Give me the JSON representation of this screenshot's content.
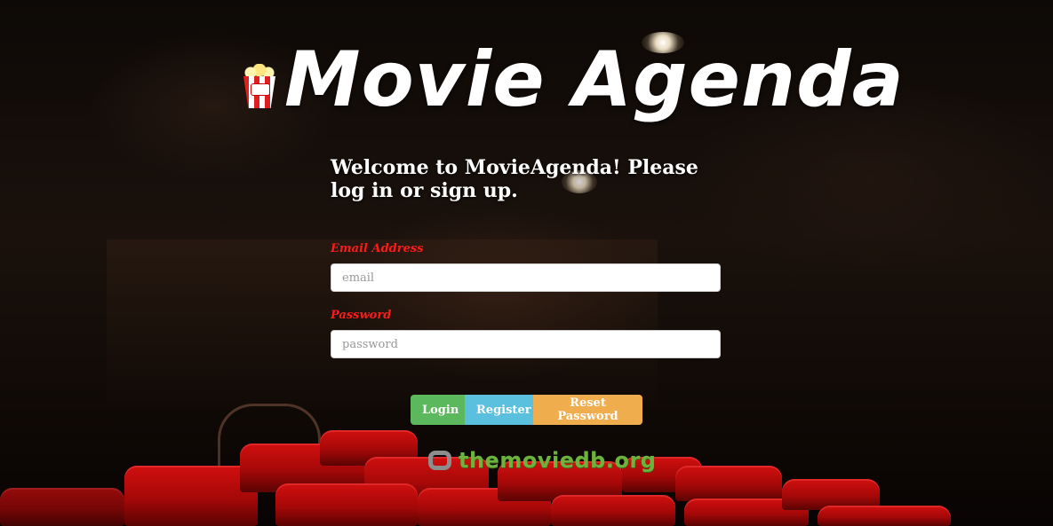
{
  "header": {
    "app_title": "Movie Agenda",
    "logo_icon": "popcorn-icon"
  },
  "welcome_message": "Welcome to MovieAgenda! Please log in or sign up.",
  "form": {
    "email": {
      "label": "Email Address",
      "placeholder": "email",
      "value": ""
    },
    "password": {
      "label": "Password",
      "placeholder": "password",
      "value": ""
    }
  },
  "buttons": {
    "login": "Login",
    "register": "Register",
    "reset": "Reset Password"
  },
  "footer": {
    "attribution": "themoviedb.org",
    "attribution_icon": "tmdb-logo-icon"
  },
  "colors": {
    "label": "#ff1a1a",
    "login": "#5cb85c",
    "register": "#5bc0de",
    "reset": "#f0ad4e",
    "attribution": "#6bb33d"
  }
}
